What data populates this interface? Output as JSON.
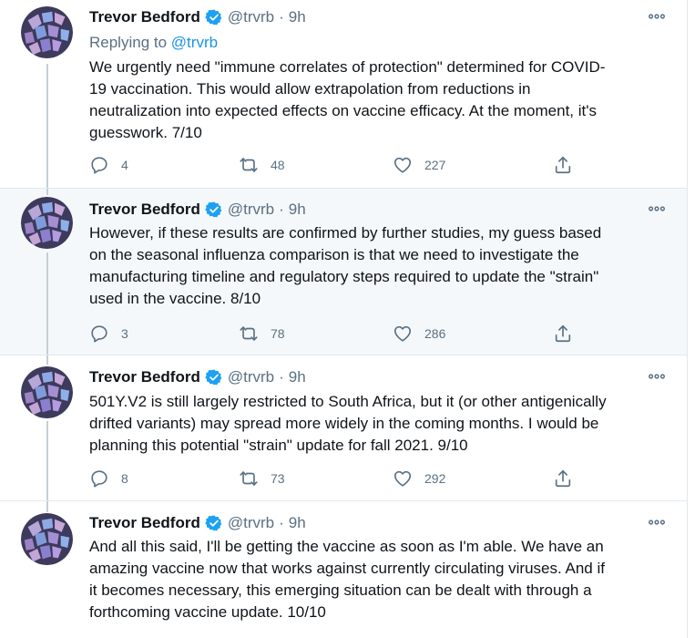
{
  "author": {
    "name": "Trevor Bedford",
    "handle": "@trvrb",
    "time": "9h",
    "separator": "·"
  },
  "colors": {
    "accent": "#1b95e0",
    "verified": "#1da1f2",
    "secondary_text": "#5b7083",
    "highlight_background": "#f5f8fa"
  },
  "tweets": [
    {
      "reply_prefix": "Replying to",
      "reply_to": "@trvrb",
      "lines": [
        "We urgently need \"immune correlates of protection\" determined for COVID-",
        "19 vaccination. This would allow extrapolation from reductions in",
        "neutralization into expected effects on vaccine efficacy. At the moment, it's",
        "guesswork. 7/10"
      ],
      "replies": "4",
      "retweets": "48",
      "likes": "227"
    },
    {
      "lines": [
        "However, if these results are confirmed by further studies, my guess based",
        "on the seasonal influenza comparison is that we need to investigate the",
        "manufacturing timeline and regulatory steps required to update the \"strain\"",
        "used in the vaccine. 8/10"
      ],
      "replies": "3",
      "retweets": "78",
      "likes": "286"
    },
    {
      "lines": [
        "501Y.V2 is still largely restricted to South Africa, but it (or other antigenically",
        "drifted variants) may spread more widely in the coming months. I would be",
        "planning this potential \"strain\" update for fall 2021. 9/10"
      ],
      "replies": "8",
      "retweets": "73",
      "likes": "292"
    },
    {
      "lines": [
        "And all this said, I'll be getting the vaccine as soon as I'm able. We have an",
        "amazing vaccine now that works against currently circulating viruses. And if",
        "it becomes necessary, this emerging situation can be dealt with through a",
        "forthcoming vaccine update. 10/10"
      ]
    }
  ]
}
